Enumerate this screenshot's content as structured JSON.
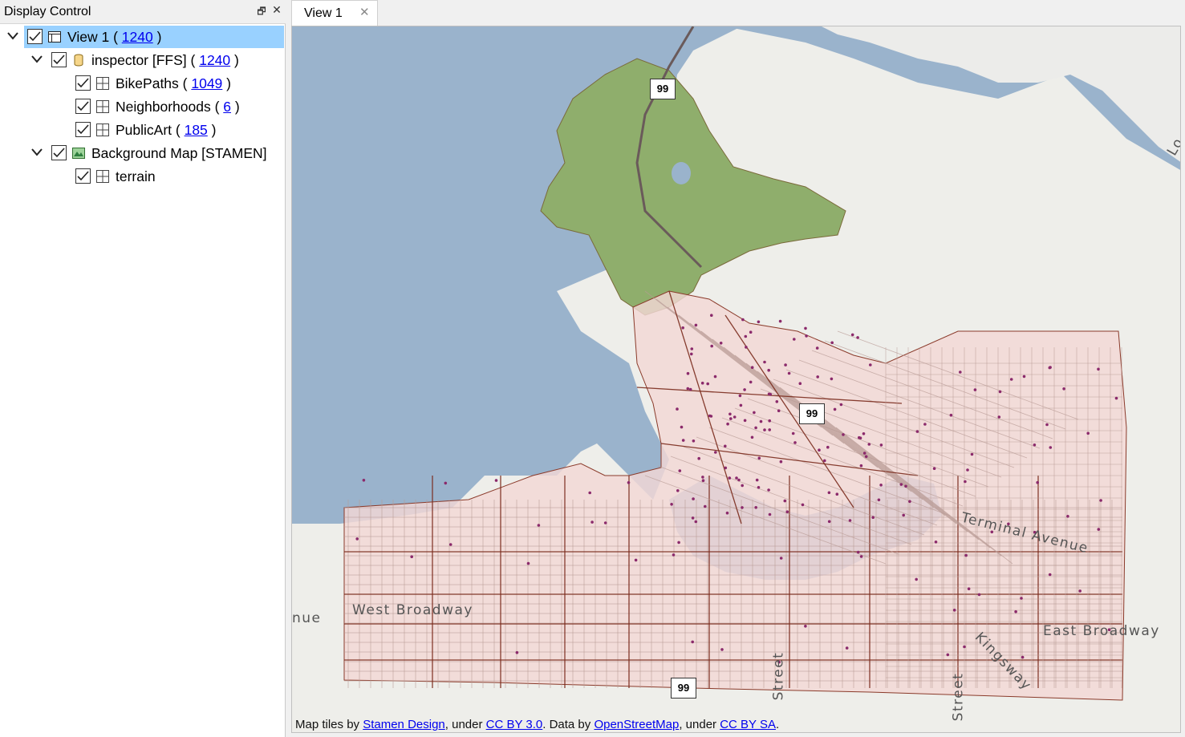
{
  "dock": {
    "title": "Display Control",
    "float_glyph": "🗗",
    "close_glyph": "✕"
  },
  "tree": {
    "view": {
      "label": "View 1",
      "open_paren": " ( ",
      "count": "1240",
      "close_paren": " )",
      "icon": "view-window-icon",
      "checked": true
    },
    "inspector": {
      "label": "inspector [FFS]",
      "open_paren": " ( ",
      "count": "1240",
      "close_paren": " )",
      "icon": "database-icon",
      "checked": true
    },
    "bikepaths": {
      "label": "BikePaths",
      "open_paren": " ( ",
      "count": "1049",
      "close_paren": " )",
      "icon": "table-grid-icon",
      "checked": true
    },
    "neighborhoods": {
      "label": "Neighborhoods",
      "open_paren": " ( ",
      "count": "6",
      "close_paren": " )",
      "icon": "table-grid-icon",
      "checked": true
    },
    "publicart": {
      "label": "PublicArt",
      "open_paren": " ( ",
      "count": "185",
      "close_paren": " )",
      "icon": "table-grid-icon",
      "checked": true
    },
    "background": {
      "label": "Background Map [STAMEN]",
      "icon": "map-layer-icon",
      "checked": true
    },
    "terrain": {
      "label": "terrain",
      "icon": "table-grid-icon",
      "checked": true
    }
  },
  "tabs": [
    {
      "label": "View 1",
      "close_glyph": "✕"
    }
  ],
  "map": {
    "highway_sign": "99",
    "street_labels": {
      "west_broadway": "West Broadway",
      "east_broadway": "East Broadway",
      "terminal_avenue": "Terminal Avenue",
      "kingsway": "Kingsway",
      "nue": "nue",
      "street1": "Street",
      "street2": "Street",
      "lo": "Lo"
    },
    "attribution": {
      "t1": "Map tiles by ",
      "l1": "Stamen Design",
      "t2": ", under ",
      "l2": "CC BY 3.0",
      "t3": ". Data by ",
      "l3": "OpenStreetMap",
      "t4": ", under ",
      "l4": "CC BY SA",
      "t5": "."
    },
    "colors": {
      "water": "#9ab3cc",
      "land": "#eeeeea",
      "park": "#8fae6c",
      "overlay": "#f3d8d6",
      "street": "#7a2a1c",
      "point": "#8b2a6b",
      "selection": "#99d1ff",
      "link": "#0000ee"
    }
  }
}
